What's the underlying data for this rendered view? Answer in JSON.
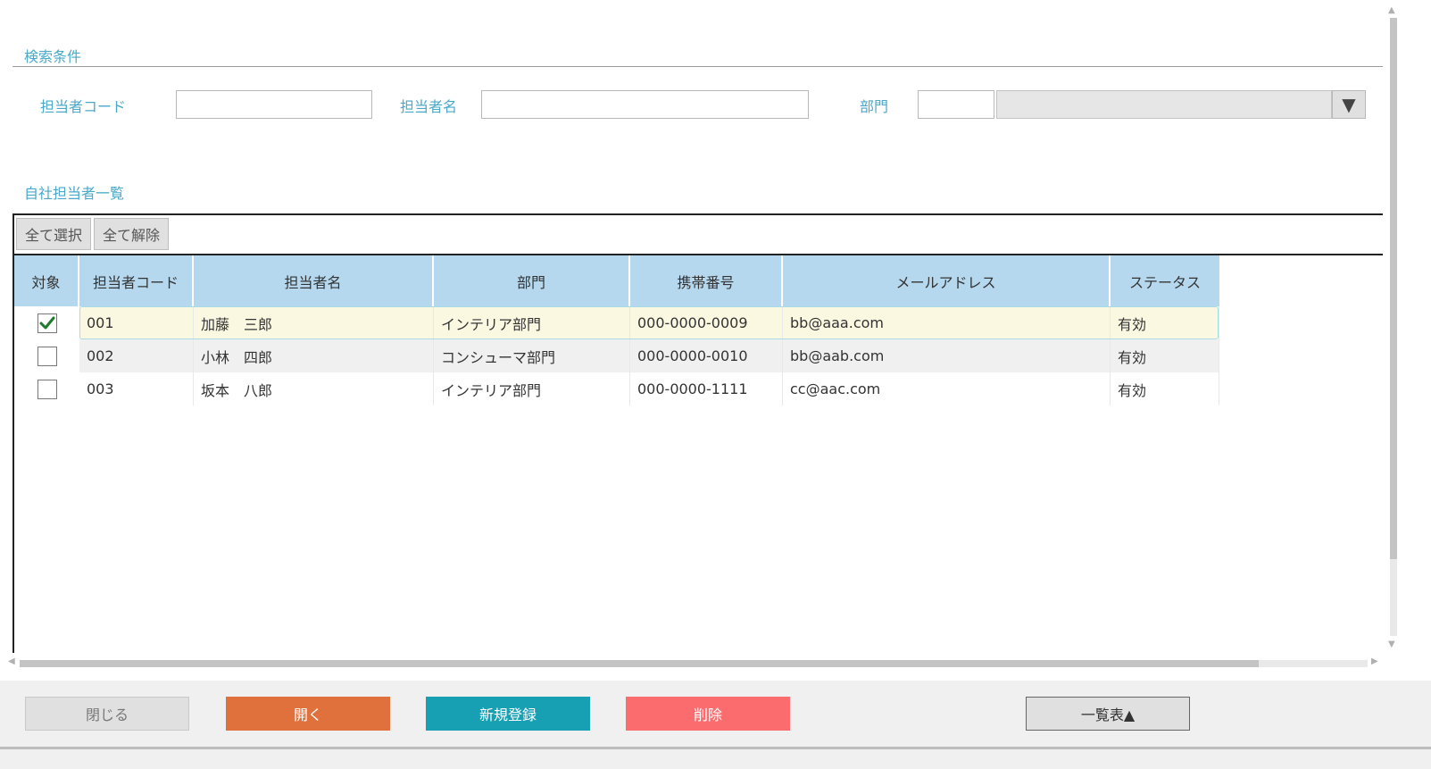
{
  "search": {
    "section_title": "検索条件",
    "code_label": "担当者コード",
    "code_value": "",
    "name_label": "担当者名",
    "name_value": "",
    "dept_label": "部門",
    "dept_code_value": "",
    "dept_name_value": "",
    "dropdown_glyph": "▼"
  },
  "list": {
    "section_title": "自社担当者一覧",
    "select_all_label": "全て選択",
    "deselect_all_label": "全て解除",
    "columns": [
      "対象",
      "担当者コード",
      "担当者名",
      "部門",
      "携帯番号",
      "メールアドレス",
      "ステータス"
    ],
    "rows": [
      {
        "checked": true,
        "code": "001",
        "name": "加藤　三郎",
        "dept": "インテリア部門",
        "phone": "000-0000-0009",
        "email": "bb@aaa.com",
        "status": "有効"
      },
      {
        "checked": false,
        "code": "002",
        "name": "小林　四郎",
        "dept": "コンシューマ部門",
        "phone": "000-0000-0010",
        "email": "bb@aab.com",
        "status": "有効"
      },
      {
        "checked": false,
        "code": "003",
        "name": "坂本　八郎",
        "dept": "インテリア部門",
        "phone": "000-0000-1111",
        "email": "cc@aac.com",
        "status": "有効"
      }
    ]
  },
  "footer": {
    "close_label": "閉じる",
    "open_label": "開く",
    "new_label": "新規登録",
    "delete_label": "削除",
    "list_label": "一覧表▲"
  },
  "colors": {
    "label": "#4aa8c9",
    "header": "#b5d8ef",
    "open_button": "#e0703c",
    "new_button": "#17a0b4",
    "delete_button": "#fb6c6f"
  }
}
